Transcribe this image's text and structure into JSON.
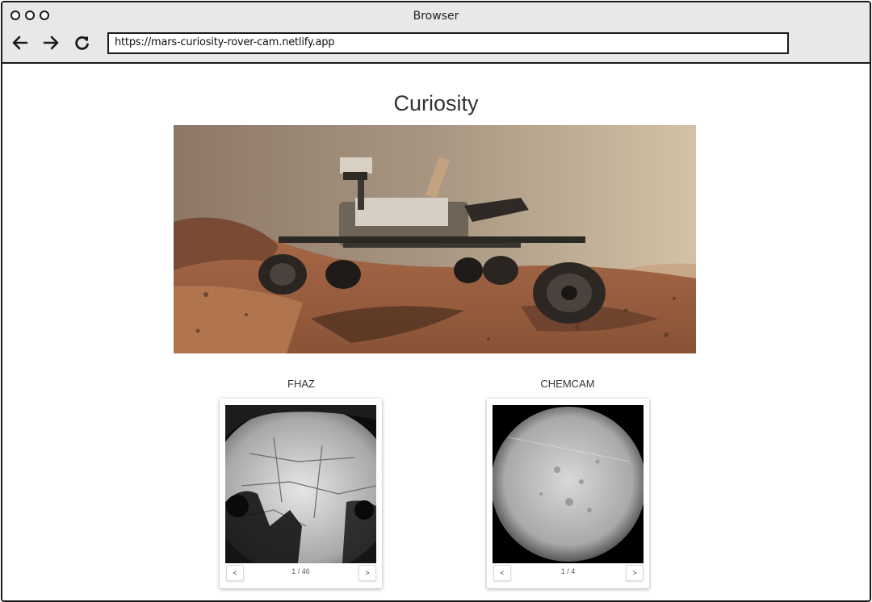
{
  "browser": {
    "title": "Browser",
    "url": "https://mars-curiosity-rover-cam.netlify.app"
  },
  "page": {
    "title": "Curiosity"
  },
  "cameras": [
    {
      "name": "FHAZ",
      "pager": "1 / 46",
      "prev_label": "<",
      "next_label": ">"
    },
    {
      "name": "CHEMCAM",
      "pager": "1 / 4",
      "prev_label": "<",
      "next_label": ">"
    }
  ],
  "icons": {
    "back": "arrow-left-icon",
    "forward": "arrow-right-icon",
    "reload": "reload-icon"
  }
}
